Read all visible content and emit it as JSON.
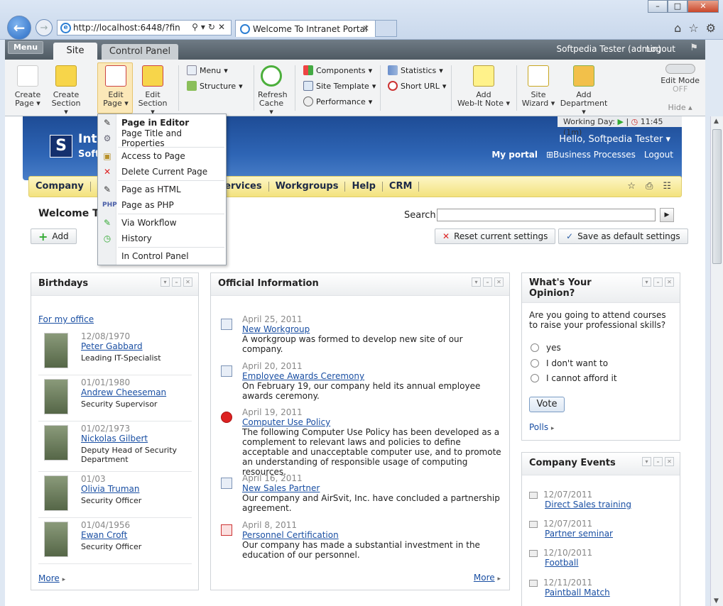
{
  "browser": {
    "address": "http://localhost:6448/?fin",
    "tab_title": "Welcome To Intranet Portal"
  },
  "panel": {
    "menu_label": "Menu",
    "tab_site": "Site",
    "tab_control_panel": "Control Panel",
    "user": "Softpedia Tester (admin)",
    "logout": "Logout",
    "big_buttons": [
      {
        "l1": "Create",
        "l2": "Page"
      },
      {
        "l1": "Create",
        "l2": "Section"
      },
      {
        "l1": "Edit",
        "l2": "Page"
      },
      {
        "l1": "Edit",
        "l2": "Section"
      },
      {
        "l1": "Refresh",
        "l2": "Cache"
      },
      {
        "l1": "Add",
        "l2": "Web-It Note"
      },
      {
        "l1": "Site",
        "l2": "Wizard"
      },
      {
        "l1": "Add",
        "l2": "Department"
      }
    ],
    "small_buttons": {
      "menu": "Menu",
      "structure": "Structure",
      "components": "Components",
      "site_template": "Site Template",
      "performance": "Performance",
      "statistics": "Statistics",
      "short_url": "Short URL"
    },
    "edit_mode": "Edit Mode",
    "edit_mode_state": "OFF",
    "hide": "Hide"
  },
  "dropdown": {
    "items": [
      "Page in Editor",
      "Page Title and Properties",
      "Access to Page",
      "Delete Current Page",
      "Page as HTML",
      "Page as PHP",
      "Via Workflow",
      "History",
      "In Control Panel"
    ]
  },
  "site": {
    "working_day": "Working Day:",
    "working_time": "11:45",
    "working_duration": "(1m)",
    "site_name": "Intr",
    "site_sub": "Soft",
    "hello": "Hello, Softpedia Tester",
    "links": [
      "My portal",
      "Business Processes",
      "Logout"
    ],
    "nav": [
      "Company",
      "Services",
      "Workgroups",
      "Help",
      "CRM"
    ],
    "welcome": "Welcome To",
    "search_label": "Search",
    "add": "Add",
    "reset": "Reset current settings",
    "save_default": "Save as default settings"
  },
  "birthdays": {
    "title": "Birthdays",
    "office_link": "For my office",
    "people": [
      {
        "date": "12/08/1970",
        "name": "Peter Gabbard",
        "job": "Leading IT-Specialist"
      },
      {
        "date": "01/01/1980",
        "name": "Andrew Cheeseman",
        "job": "Security Supervisor"
      },
      {
        "date": "01/02/1973",
        "name": "Nickolas Gilbert",
        "job": "Deputy Head of Security Department"
      },
      {
        "date": "01/03",
        "name": "Olivia Truman",
        "job": "Security Officer"
      },
      {
        "date": "01/04/1956",
        "name": "Ewan Croft",
        "job": "Security Officer"
      }
    ],
    "more": "More"
  },
  "official": {
    "title": "Official Information",
    "items": [
      {
        "date": "April 25, 2011",
        "title": "New Workgroup",
        "text": "A workgroup was formed to develop new site of our company."
      },
      {
        "date": "April 20, 2011",
        "title": "Employee Awards Ceremony",
        "text": "On February 19, our company held its annual employee awards ceremony."
      },
      {
        "date": "April 19, 2011",
        "title": "Computer Use Policy",
        "text": "The following Computer Use Policy has been developed as a complement to relevant laws and policies to define acceptable and unacceptable computer use, and to promote an understanding of responsible usage of computing resources."
      },
      {
        "date": "April 16, 2011",
        "title": "New Sales Partner",
        "text": "Our company and AirSvit, Inc. have concluded a partnership agreement."
      },
      {
        "date": "April 8, 2011",
        "title": "Personnel Certification",
        "text": "Our company has made a substantial investment in the education of our personnel."
      }
    ],
    "more": "More"
  },
  "opinion": {
    "title": "What's Your Opinion?",
    "question": "Are you going to attend courses to raise your professional skills?",
    "options": [
      "yes",
      "I don't want to",
      "I cannot afford it"
    ],
    "vote": "Vote",
    "polls": "Polls"
  },
  "events": {
    "title": "Company Events",
    "items": [
      {
        "date": "12/07/2011",
        "title": "Direct Sales training"
      },
      {
        "date": "12/07/2011",
        "title": "Partner seminar"
      },
      {
        "date": "12/10/2011",
        "title": "Football"
      },
      {
        "date": "12/11/2011",
        "title": "Paintball Match"
      }
    ]
  }
}
